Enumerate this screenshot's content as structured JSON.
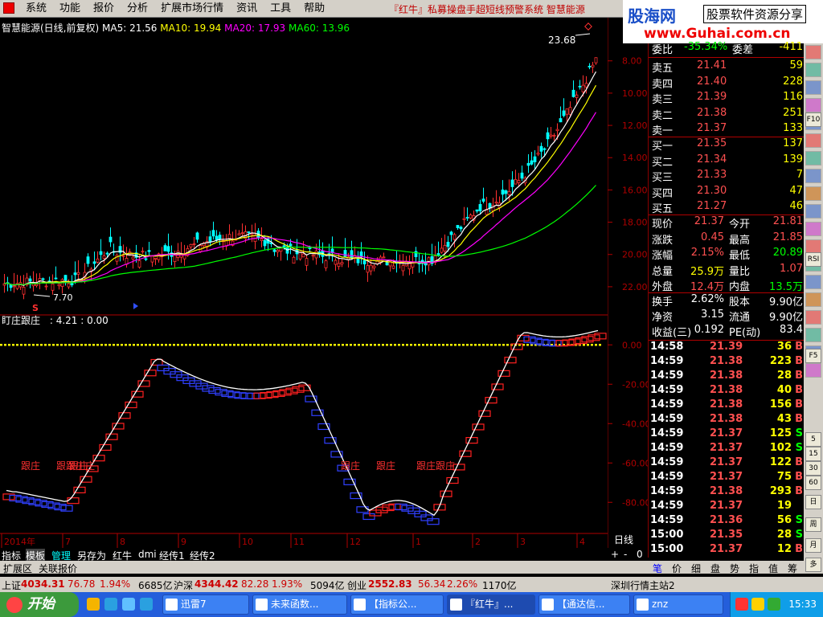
{
  "menu": {
    "items": [
      "系统",
      "功能",
      "报价",
      "分析",
      "扩展市场行情",
      "资讯",
      "工具",
      "帮助"
    ],
    "title": "『红牛』私募操盘手超短线预警系统  智慧能源"
  },
  "brand": {
    "name": "股海网",
    "slogan": "股票软件资源分享",
    "url": "www.Guhai.com.cn"
  },
  "chart": {
    "stock_label": "智慧能源(日线,前复权)",
    "ma5": "MA5: 21.56",
    "ma10": "MA10: 19.94",
    "ma20": "MA20: 17.93",
    "ma60": "MA60: 13.96",
    "high_label": "23.68",
    "low_label": "7.70",
    "sub_title": "盯庄跟庄",
    "sub_values": ": 4.21 : 0.00",
    "period_label": "日线",
    "signal_label": "跟庄",
    "signal_label_multi": "跟跟庄庄",
    "signal_marker": "S"
  },
  "chart_data": {
    "type": "line",
    "title": "智慧能源(日线,前复权)",
    "price_axis": {
      "ylim": [
        7,
        23.68
      ],
      "ticks": [
        8.0,
        10.0,
        12.0,
        14.0,
        16.0,
        18.0,
        20.0,
        22.0
      ]
    },
    "indicator_axis": {
      "ylim": [
        -95,
        5
      ],
      "ticks": [
        0.0,
        -20.0,
        -40.0,
        -60.0,
        -80.0
      ]
    },
    "x_ticks": [
      "2014年",
      "7",
      "8",
      "9",
      "10",
      "11",
      "12",
      "1",
      "2",
      "3",
      "4"
    ],
    "series": [
      {
        "name": "MA5",
        "value": 21.56,
        "color": "#ffffff"
      },
      {
        "name": "MA10",
        "value": 19.94,
        "color": "#ffff00"
      },
      {
        "name": "MA20",
        "value": 17.93,
        "color": "#ff00ff"
      },
      {
        "name": "MA60",
        "value": 13.96,
        "color": "#00ff00"
      }
    ],
    "highest": 23.68,
    "lowest": 7.7
  },
  "axis": {
    "price_ticks": [
      "22.00",
      "20.00",
      "18.00",
      "16.00",
      "14.00",
      "12.00",
      "10.00",
      "8.00"
    ],
    "indicator_ticks": [
      "0.00",
      "-20.00",
      "-40.00",
      "-60.00",
      "-80.00"
    ]
  },
  "quote": {
    "weibi": {
      "k1": "委比",
      "v1": "-35.34%",
      "k2": "委差",
      "v2": "-411"
    },
    "asks": [
      {
        "k": "卖五",
        "p": "21.41",
        "v": "59"
      },
      {
        "k": "卖四",
        "p": "21.40",
        "v": "228"
      },
      {
        "k": "卖三",
        "p": "21.39",
        "v": "116"
      },
      {
        "k": "卖二",
        "p": "21.38",
        "v": "251"
      },
      {
        "k": "卖一",
        "p": "21.37",
        "v": "133"
      }
    ],
    "bids": [
      {
        "k": "买一",
        "p": "21.35",
        "v": "137"
      },
      {
        "k": "买二",
        "p": "21.34",
        "v": "139"
      },
      {
        "k": "买三",
        "p": "21.33",
        "v": "7"
      },
      {
        "k": "买四",
        "p": "21.30",
        "v": "47"
      },
      {
        "k": "买五",
        "p": "21.27",
        "v": "46"
      }
    ],
    "stats": [
      {
        "k1": "现价",
        "v1": "21.37",
        "k2": "今开",
        "v2": "21.81"
      },
      {
        "k1": "涨跌",
        "v1": "0.45",
        "k2": "最高",
        "v2": "21.85"
      },
      {
        "k1": "涨幅",
        "v1": "2.15%",
        "k2": "最低",
        "v2": "20.89"
      },
      {
        "k1": "总量",
        "v1": "25.9万",
        "k2": "量比",
        "v2": "1.07"
      },
      {
        "k1": "外盘",
        "v1": "12.4万",
        "k2": "内盘",
        "v2": "13.5万"
      }
    ],
    "stats2": [
      {
        "k1": "换手",
        "v1": "2.62%",
        "k2": "股本",
        "v2": "9.90亿"
      },
      {
        "k1": "净资",
        "v1": "3.15",
        "k2": "流通",
        "v2": "9.90亿"
      },
      {
        "k1": "收益(三)",
        "v1": "0.192",
        "k2": "PE(动)",
        "v2": "83.4"
      }
    ],
    "ticks": [
      {
        "t": "14:58",
        "p": "21.39",
        "v": "36",
        "bs": "B"
      },
      {
        "t": "14:59",
        "p": "21.38",
        "v": "223",
        "bs": "B"
      },
      {
        "t": "14:59",
        "p": "21.38",
        "v": "28",
        "bs": "B"
      },
      {
        "t": "14:59",
        "p": "21.38",
        "v": "40",
        "bs": "B"
      },
      {
        "t": "14:59",
        "p": "21.38",
        "v": "156",
        "bs": "B"
      },
      {
        "t": "14:59",
        "p": "21.38",
        "v": "43",
        "bs": "B"
      },
      {
        "t": "14:59",
        "p": "21.37",
        "v": "125",
        "bs": "S"
      },
      {
        "t": "14:59",
        "p": "21.37",
        "v": "102",
        "bs": "S"
      },
      {
        "t": "14:59",
        "p": "21.37",
        "v": "122",
        "bs": "B"
      },
      {
        "t": "14:59",
        "p": "21.37",
        "v": "75",
        "bs": "B"
      },
      {
        "t": "14:59",
        "p": "21.38",
        "v": "293",
        "bs": "B"
      },
      {
        "t": "14:59",
        "p": "21.37",
        "v": "19",
        "bs": ""
      },
      {
        "t": "14:59",
        "p": "21.36",
        "v": "56",
        "bs": "S"
      },
      {
        "t": "15:00",
        "p": "21.35",
        "v": "28",
        "bs": "S"
      },
      {
        "t": "15:00",
        "p": "21.37",
        "v": "12",
        "bs": "B"
      }
    ]
  },
  "bottom": {
    "tabs": [
      "指标",
      "模板",
      "管理",
      "另存为",
      "红牛",
      "dmi",
      "经传1",
      "经传2"
    ],
    "controls": [
      "+",
      "-",
      "0"
    ],
    "tabs2": [
      "扩展区",
      "关联报价"
    ],
    "quote_tabs": [
      "笔",
      "价",
      "细",
      "盘",
      "势",
      "指",
      "值",
      "筹"
    ]
  },
  "index_bar": {
    "sh_label": "上证",
    "sh_val": "4034.31",
    "sh_chg": "76.78",
    "sh_pct": "1.94%",
    "sh_amt": "6685亿",
    "sz_label": "沪深",
    "sz_val": "4344.42",
    "sz_chg": "82.28",
    "sz_pct": "1.93%",
    "sz_amt": "5094亿",
    "cy_label": "创业",
    "cy_val": "2552.83",
    "cy_chg": "56.34",
    "cy_pct": "2.26%",
    "cy_amt": "1170亿",
    "server": "深圳行情主站2"
  },
  "taskbar": {
    "start": "开始",
    "windows": [
      "迅雷7",
      "未来函数...",
      "【指标公...",
      "『红牛』...",
      "【通达信...",
      "znz"
    ],
    "clock": "15:33"
  },
  "side_icons": [
    "F10",
    "RSI",
    "F5",
    "5",
    "15",
    "30",
    "60",
    "日",
    "周",
    "月",
    "多"
  ]
}
